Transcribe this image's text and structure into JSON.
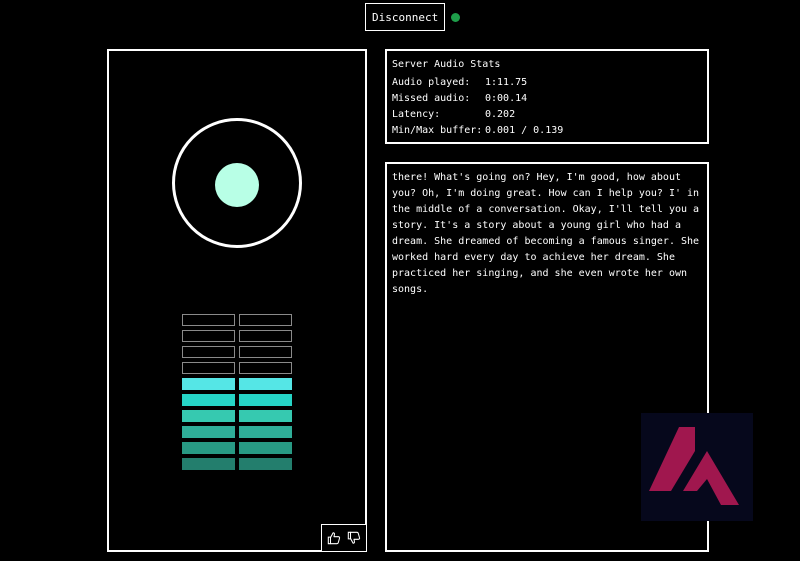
{
  "header": {
    "disconnect_label": "Disconnect",
    "status_color": "#1e9e4a"
  },
  "visualizer": {
    "orb_color": "#b8ffe6",
    "meter": {
      "rows": 10,
      "columns": 2,
      "level": 0.6,
      "active_colors": [
        "#55e6e6",
        "#26d4c6",
        "#36c9b0",
        "#2fae98",
        "#289a84",
        "#237e6d"
      ]
    },
    "feedback": {
      "thumbs_up_icon": "thumbs-up-icon",
      "thumbs_down_icon": "thumbs-down-icon"
    }
  },
  "stats": {
    "title": "Server Audio Stats",
    "rows": [
      {
        "label": "Audio played:",
        "value": "1:11.75"
      },
      {
        "label": "Missed audio:",
        "value": "0:00.14"
      },
      {
        "label": "Latency:",
        "value": "0.202"
      },
      {
        "label": "Min/Max buffer:",
        "value": "0.001 / 0.139"
      }
    ]
  },
  "transcript": {
    "text": "there! What's going on? Hey, I'm good, how about you? Oh, I'm doing great. How can I help you? I' in the middle of a conversation. Okay, I'll tell you a story. It's a story about a young girl who had a dream. She dreamed of becoming a famous singer. She worked hard every day to achieve her dream. She practiced her singing, and she even wrote her own songs."
  },
  "watermark": {
    "icon": "kyutai-logo-icon",
    "accent_color": "#a0174e"
  }
}
